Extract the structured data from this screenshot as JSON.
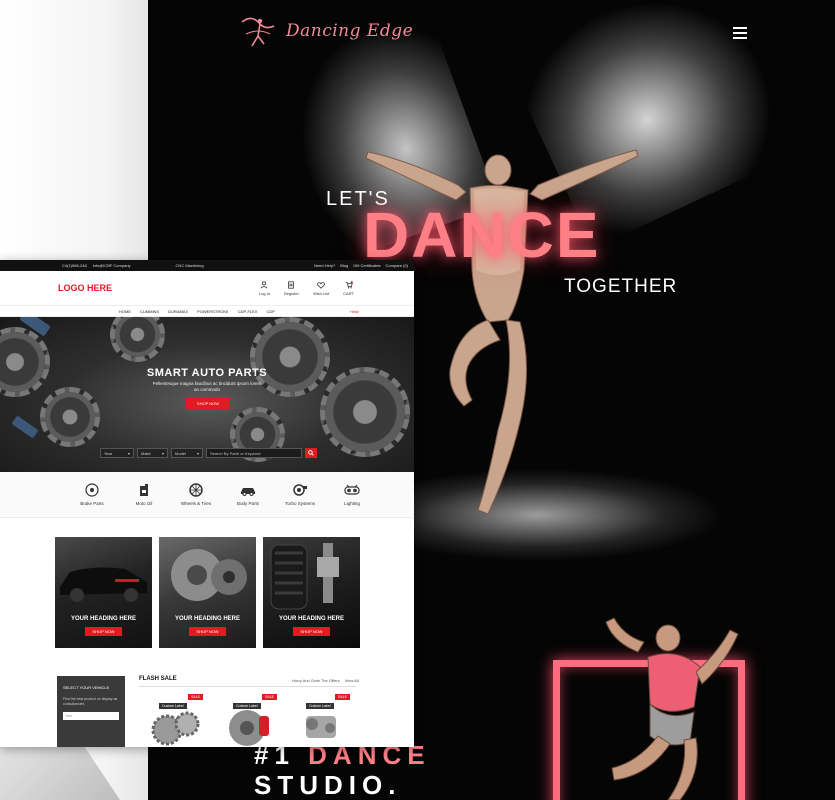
{
  "dance": {
    "logo_text": "Dancing Edge",
    "headline_top": "LET'S",
    "headline_main": "DANCE",
    "headline_bottom": "TOGETHER",
    "studio_hash": "#1",
    "studio_word": "DANCE",
    "studio_line2": "STUDIO.",
    "icons": {
      "logo": "dancer-logo-icon",
      "menu": "hamburger-menu-icon"
    },
    "colors": {
      "accent": "#ff7f86",
      "background": "#050505"
    }
  },
  "auto": {
    "topbar": {
      "phone": "C4(1)566-248",
      "email": "info@ICBF Company",
      "middle": "CNC Machining",
      "links": [
        "Need Help?",
        "Blog",
        "Gift Certificates",
        "Compare (0)"
      ]
    },
    "logo": "LOGO HERE",
    "header_icons": [
      {
        "label": "Log In",
        "icon": "user-icon"
      },
      {
        "label": "Register",
        "icon": "register-icon"
      },
      {
        "label": "Wish List",
        "icon": "heart-icon"
      },
      {
        "label": "CART",
        "icon": "cart-icon"
      }
    ],
    "nav": [
      "HOME",
      "CUMMINS",
      "DURAMAX",
      "POWERSTROKE",
      "CDP-FLEX",
      "CDP"
    ],
    "nav_help": "Help!",
    "hero": {
      "title": "SMART AUTO PARTS",
      "subtitle": "Pellentesque magna faucibus ac tincidunt ipsum lorem an commodo",
      "button": "SHOP NOW"
    },
    "search": {
      "selects": [
        "Year",
        "Make",
        "Model"
      ],
      "placeholder": "Search By Part# or Keyword"
    },
    "categories": [
      {
        "label": "Brake Parts",
        "icon": "brake-disc-icon"
      },
      {
        "label": "Moto Oil",
        "icon": "oil-can-icon"
      },
      {
        "label": "Wheels & Tires",
        "icon": "wheel-icon"
      },
      {
        "label": "Body Parts",
        "icon": "car-body-icon"
      },
      {
        "label": "Turbo Systems",
        "icon": "turbo-icon"
      },
      {
        "label": "Lighting",
        "icon": "headlight-icon"
      }
    ],
    "promos": [
      {
        "heading": "YOUR HEADING HERE",
        "button": "SHOP NOW"
      },
      {
        "heading": "YOUR HEADING HERE",
        "button": "SHOP NOW"
      },
      {
        "heading": "YOUR HEADING HERE",
        "button": "SHOP NOW"
      }
    ],
    "vehicle": {
      "title": "SELECT YOUR VEHICLE",
      "desc": "Find the best product on display as consultancies",
      "input": "Year"
    },
    "flash": {
      "title": "FLASH SALE",
      "right": "Hurry And Grab The Offers",
      "view_all": "View All",
      "products": [
        {
          "badge": "SALE",
          "label": "Custom Label"
        },
        {
          "badge": "SALE",
          "label": "Custom Label"
        },
        {
          "badge": "SALE",
          "label": "Custom Label"
        }
      ]
    },
    "colors": {
      "accent": "#e21b23"
    }
  }
}
